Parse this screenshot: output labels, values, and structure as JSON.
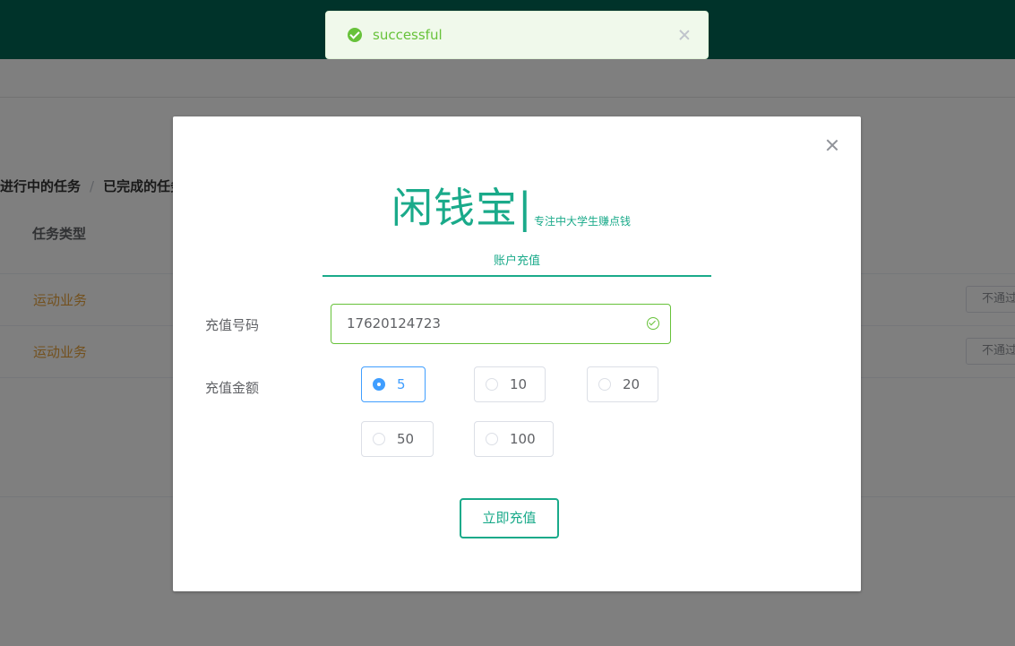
{
  "background": {
    "breadcrumb": {
      "current": "进行中的任务",
      "separator": "/",
      "next": "已完成的任务"
    },
    "table": {
      "header": "任务类型",
      "rows": [
        {
          "type": "运动业务",
          "status_button": "不通过"
        },
        {
          "type": "运动业务",
          "status_button": "不通过"
        }
      ]
    }
  },
  "dialog": {
    "logo": "闲钱宝|",
    "slogan": "专注中大学生赚点钱",
    "tab": "账户充值",
    "phone_label": "充值号码",
    "phone_value": "17620124723",
    "amount_label": "充值金额",
    "amounts": [
      {
        "label": "5",
        "checked": true
      },
      {
        "label": "10",
        "checked": false
      },
      {
        "label": "20",
        "checked": false
      },
      {
        "label": "50",
        "checked": false
      },
      {
        "label": "100",
        "checked": false
      }
    ],
    "submit": "立即充值"
  },
  "notification": {
    "message": "successful",
    "type": "success"
  },
  "colors": {
    "brand": "#1aaa8a",
    "topbar": "#006655",
    "success": "#67c23a",
    "radio_active": "#409eff",
    "warning_text": "#e6a23c"
  }
}
